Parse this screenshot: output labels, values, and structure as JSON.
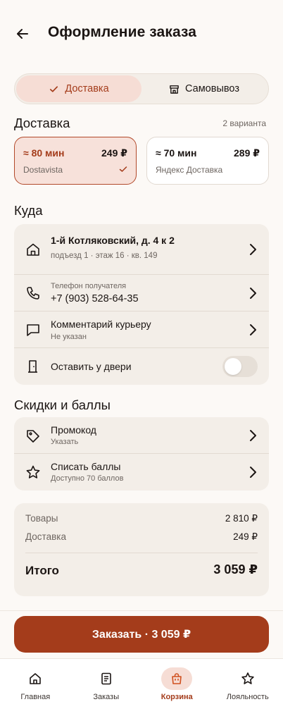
{
  "header": {
    "title": "Оформление заказа"
  },
  "segment": {
    "delivery": "Доставка",
    "pickup": "Самовывоз"
  },
  "delivery": {
    "title": "Доставка",
    "hint": "2 варианта",
    "options": [
      {
        "time": "≈ 80 мин",
        "price": "249 ₽",
        "name": "Dostavista",
        "selected": true
      },
      {
        "time": "≈ 70 мин",
        "price": "289 ₽",
        "name": "Яндекс Доставка",
        "selected": false
      }
    ]
  },
  "where": {
    "title": "Куда",
    "address": "1-й Котляковский, д. 4 к 2",
    "address_details": "подъезд 1 · этаж 16 · кв. 149",
    "phone_label": "Телефон получателя",
    "phone": "+7 (903) 528-64-35",
    "comment_title": "Комментарий курьеру",
    "comment_value": "Не указан",
    "leave_door": "Оставить у двери",
    "leave_door_enabled": false
  },
  "discounts": {
    "title": "Скидки и баллы",
    "promo_title": "Промокод",
    "promo_sub": "Указать",
    "points_title": "Списать баллы",
    "points_sub": "Доступно 70 баллов"
  },
  "summary": {
    "goods_label": "Товары",
    "goods_value": "2 810 ₽",
    "delivery_label": "Доставка",
    "delivery_value": "249 ₽",
    "total_label": "Итого",
    "total_value": "3 059 ₽"
  },
  "cta": {
    "label": "Заказать · 3 059 ₽"
  },
  "tabs": [
    {
      "label": "Главная",
      "icon": "home-icon"
    },
    {
      "label": "Заказы",
      "icon": "orders-icon"
    },
    {
      "label": "Корзина",
      "icon": "bag-icon",
      "active": true
    },
    {
      "label": "Лояльность",
      "icon": "star-icon"
    }
  ],
  "colors": {
    "accent": "#A43C1B",
    "accent_soft": "#F6DDD5",
    "card": "#F3EEE8",
    "bg": "#FCF9F6"
  }
}
